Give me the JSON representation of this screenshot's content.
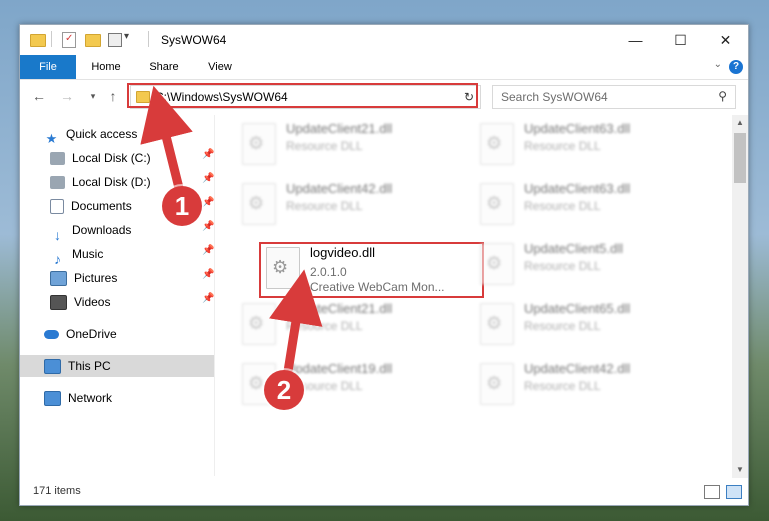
{
  "window": {
    "title": "SysWOW64"
  },
  "window_controls": {
    "minimize": "—",
    "maximize": "☐",
    "close": "✕"
  },
  "ribbon": {
    "tabs": [
      "File",
      "Home",
      "Share",
      "View"
    ],
    "help": "?"
  },
  "address": {
    "path": "C:\\Windows\\SysWOW64"
  },
  "search": {
    "placeholder": "Search SysWOW64"
  },
  "nav": {
    "items": [
      {
        "label": "Quick access",
        "icon": "star-icon"
      },
      {
        "label": "Local Disk (C:)",
        "icon": "drive-icon"
      },
      {
        "label": "Local Disk (D:)",
        "icon": "drive-icon"
      },
      {
        "label": "Documents",
        "icon": "documents-icon"
      },
      {
        "label": "Downloads",
        "icon": "download-icon"
      },
      {
        "label": "Music",
        "icon": "music-icon"
      },
      {
        "label": "Pictures",
        "icon": "pictures-icon"
      },
      {
        "label": "Videos",
        "icon": "videos-icon"
      },
      {
        "label": "OneDrive",
        "icon": "cloud-icon"
      },
      {
        "label": "This PC",
        "icon": "computer-icon"
      },
      {
        "label": "Network",
        "icon": "network-icon"
      }
    ]
  },
  "files": {
    "col1": [
      {
        "name": "UpdateClient21.dll",
        "type": "Resource DLL"
      },
      {
        "name": "UpdateClient42.dll",
        "type": "Resource DLL"
      },
      {
        "name": "logvideo.dll",
        "version": "2.0.1.0",
        "desc": "Creative WebCam Mon..."
      },
      {
        "name": "UpdateClient21.dll",
        "type": "Resource DLL"
      },
      {
        "name": "UpdateClient19.dll",
        "type": "Resource DLL"
      }
    ],
    "col2": [
      {
        "name": "UpdateClient63.dll",
        "type": "Resource DLL"
      },
      {
        "name": "UpdateClient63.dll",
        "type": "Resource DLL"
      },
      {
        "name": "UpdateClient5.dll",
        "type": "Resource DLL"
      },
      {
        "name": "UpdateClient65.dll",
        "type": "Resource DLL"
      },
      {
        "name": "UpdateClient42.dll",
        "type": "Resource DLL"
      }
    ]
  },
  "status": {
    "items": "171 items"
  },
  "annotations": {
    "step1": "1",
    "step2": "2",
    "color": "#d83b3b"
  }
}
